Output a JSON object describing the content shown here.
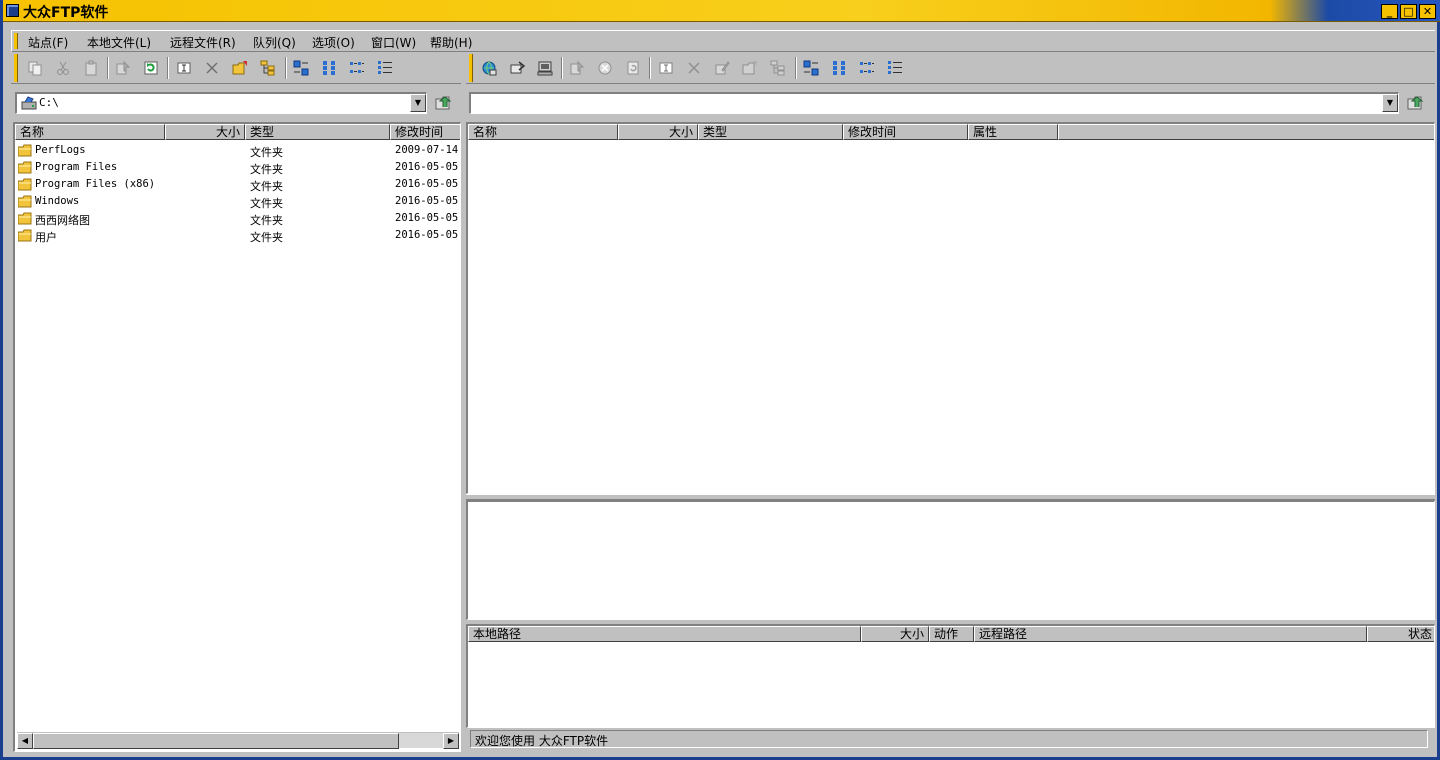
{
  "window": {
    "title": "大众FTP软件",
    "min_label": "_",
    "max_label": "□",
    "close_label": "✕"
  },
  "menu": [
    {
      "label": "站点(F)"
    },
    {
      "label": "本地文件(L)"
    },
    {
      "label": "远程文件(R)"
    },
    {
      "label": "队列(Q)"
    },
    {
      "label": "选项(O)"
    },
    {
      "label": "窗口(W)"
    },
    {
      "label": "帮助(H)"
    }
  ],
  "local": {
    "path": "C:\\",
    "columns": [
      "名称",
      "大小",
      "类型",
      "修改时间"
    ],
    "files": [
      {
        "name": "PerfLogs",
        "size": "",
        "type": "文件夹",
        "modified": "2009-07-14"
      },
      {
        "name": "Program Files",
        "size": "",
        "type": "文件夹",
        "modified": "2016-05-05"
      },
      {
        "name": "Program Files (x86)",
        "size": "",
        "type": "文件夹",
        "modified": "2016-05-05"
      },
      {
        "name": "Windows",
        "size": "",
        "type": "文件夹",
        "modified": "2016-05-05"
      },
      {
        "name": "西西网络图",
        "size": "",
        "type": "文件夹",
        "modified": "2016-05-05"
      },
      {
        "name": "用户",
        "size": "",
        "type": "文件夹",
        "modified": "2016-05-05"
      }
    ]
  },
  "remote": {
    "path": "",
    "columns": [
      "名称",
      "大小",
      "类型",
      "修改时间",
      "属性"
    ]
  },
  "queue": {
    "columns": [
      "本地路径",
      "大小",
      "动作",
      "远程路径",
      "状态"
    ]
  },
  "status": {
    "text": "欢迎您使用 大众FTP软件"
  },
  "colors": {
    "titlebar": "#f6c200",
    "frame": "#1b3f8f",
    "face": "#c0c0c0",
    "folder": "#f2c43c"
  }
}
